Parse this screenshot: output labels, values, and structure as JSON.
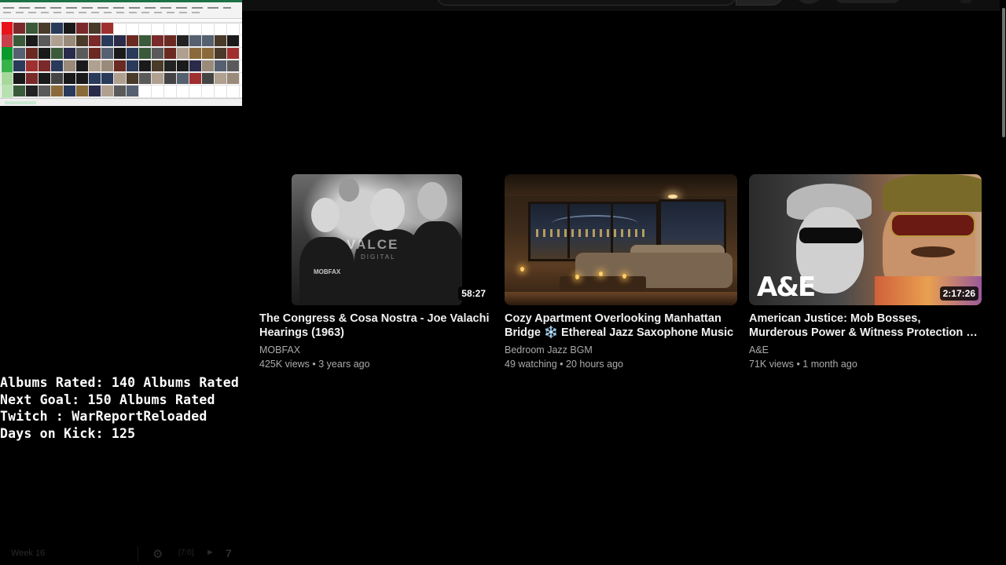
{
  "stream_overlay": {
    "albums_rated": "Albums Rated: 140 Albums Rated",
    "next_goal": "Next Goal: 150 Albums Rated",
    "twitch": "Twitch : WarReportReloaded",
    "days_on_kick": "Days on Kick: 125"
  },
  "bottom_bar": {
    "left_text": "Week 16",
    "small_text": "[7:0]",
    "number": "7"
  },
  "tier_colors": [
    "#e8131b",
    "#c9404a",
    "#0a9a2a",
    "#37b34a",
    "#a6d89a",
    "#b8e0b0",
    "#c4e8c8"
  ],
  "videos": [
    {
      "title": "The Congress & Cosa Nostra - Joe Valachi Hearings (1963)",
      "channel": "MOBFAX",
      "meta": "425K views • 3 years ago",
      "duration": "58:27",
      "watermark": "VALCE",
      "watermark_sub": "DIGITAL",
      "watermark_label": "MOBFAX"
    },
    {
      "title": "Cozy Apartment Overlooking Manhattan Bridge ❄️ Ethereal Jazz Saxophone Music",
      "channel": "Bedroom Jazz BGM",
      "meta": "49 watching • 20 hours ago",
      "duration": ""
    },
    {
      "title": "American Justice: Mob Bosses, Murderous Power & Witness Protection – Full Episode",
      "channel": "A&E",
      "meta": "71K views • 1 month ago",
      "duration": "2:17:26",
      "logo": "A&E"
    }
  ]
}
